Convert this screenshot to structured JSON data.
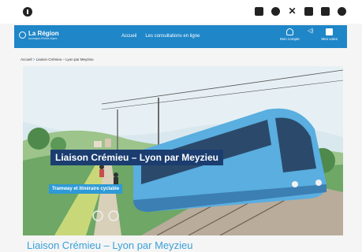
{
  "topbar": {
    "left_icon": "info-icon",
    "social_icons": [
      "linkedin-icon",
      "facebook-icon",
      "x-icon",
      "instagram-icon",
      "youtube-icon",
      "globe-icon"
    ]
  },
  "navbar": {
    "brand": "La Région",
    "brand_sub": "Auvergne-Rhône-Alpes",
    "links": [
      "Accueil",
      "Les consultations en ligne"
    ],
    "account_label": "Mon compte",
    "votes_label": "Mes votes",
    "color": "#1f86c8"
  },
  "breadcrumb": {
    "home": "Accueil",
    "separator": ">",
    "current": "Liaison Crémieu – Lyon par Meyzieu"
  },
  "hero": {
    "title": "Liaison Crémieu – Lyon par Meyzieu",
    "tag": "Tramway et itinéraire cyclable"
  },
  "page": {
    "title": "Liaison Crémieu – Lyon par Meyzieu"
  }
}
